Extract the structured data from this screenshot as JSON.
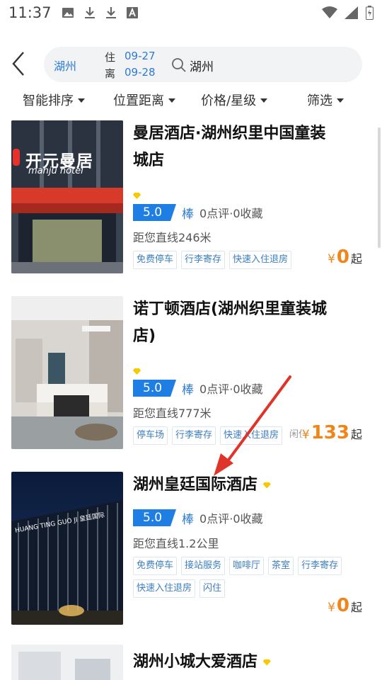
{
  "status_bar": {
    "time": "11:37"
  },
  "search": {
    "city": "湖州",
    "checkin_label": "住",
    "checkin": "09-27",
    "checkout_label": "离",
    "checkout": "09-28",
    "query": "湖州"
  },
  "filters": [
    "智能排序",
    "位置距离",
    "价格/星级",
    "筛选"
  ],
  "hotels": [
    {
      "name_line1": "曼居酒店·湖州织里中国童装",
      "name_line2": "城店",
      "score": "5.0",
      "word": "棒",
      "reviews": "0点评·0收藏",
      "distance": "距您直线246米",
      "tags": [
        "免费停车",
        "行李寄存",
        "快速入住退房"
      ],
      "price": "0",
      "sign_text": "开元曼居",
      "sign_sub": "manju hotel"
    },
    {
      "name_line1": "诺丁顿酒店(湖州织里童装城",
      "name_line2": "店)",
      "score": "5.0",
      "word": "棒",
      "reviews": "0点评·0收藏",
      "distance": "距您直线777米",
      "tags": [
        "停车场",
        "行李寄存",
        "快速入住退房",
        "闲住"
      ],
      "price": "133"
    },
    {
      "name": "湖州皇廷国际酒店",
      "score": "5.0",
      "word": "棒",
      "reviews": "0点评·0收藏",
      "distance": "距您直线1.2公里",
      "tags": [
        "免费停车",
        "接站服务",
        "咖啡厅",
        "茶室",
        "行李寄存",
        "快速入住退房",
        "闪住"
      ],
      "price": "0",
      "sign_text": "HUANG TING GUO JI 皇廷国际"
    },
    {
      "name": "湖州小城大爱酒店"
    }
  ],
  "price_symbol": "¥",
  "price_suffix": "起",
  "colors": {
    "accent": "#2d7ad6",
    "score_bg": "#1f7ee3",
    "price": "#f08519",
    "annotation_arrow": "#e0342b"
  }
}
